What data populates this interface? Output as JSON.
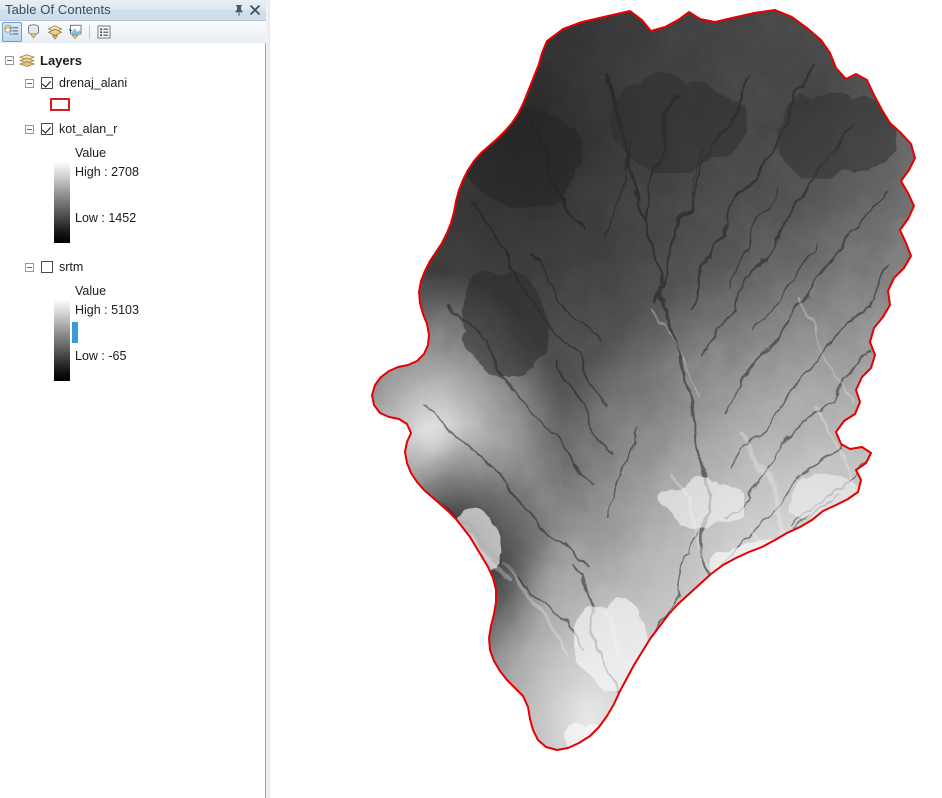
{
  "panel": {
    "title": "Table Of Contents",
    "pin_icon": "pin-icon",
    "close_icon": "close-icon",
    "toolbar": [
      {
        "name": "list-by-drawing-order-icon",
        "active": true
      },
      {
        "name": "list-by-source-icon",
        "active": false
      },
      {
        "name": "list-by-visibility-icon",
        "active": false
      },
      {
        "name": "list-by-selection-icon",
        "active": false
      },
      {
        "name": "options-icon",
        "active": false
      }
    ]
  },
  "tree": {
    "root": {
      "label": "Layers",
      "icon": "layer-stack-icon",
      "expanded": true
    },
    "layers": [
      {
        "name": "drenaj_alani",
        "checked": true,
        "expanded": true,
        "symbol_type": "polygon-outline",
        "outline_color": "#d41f1f",
        "fill_color": "#ffffff"
      },
      {
        "name": "kot_alan_r",
        "checked": true,
        "expanded": true,
        "symbol_type": "stretched-raster",
        "value_label": "Value",
        "high_label": "High : 2708",
        "low_label": "Low : 1452",
        "ramp_high_color": "#ffffff",
        "ramp_low_color": "#000000",
        "selected": false
      },
      {
        "name": "srtm",
        "checked": false,
        "expanded": true,
        "symbol_type": "stretched-raster",
        "value_label": "Value",
        "high_label": "High : 5103",
        "low_label": "Low : -65",
        "ramp_high_color": "#ffffff",
        "ramp_low_color": "#000000",
        "selected": true,
        "selection_color": "#3a9ae0"
      }
    ]
  },
  "map": {
    "background_color": "#ffffff",
    "boundary_color": "#e60000",
    "boundary_layer": "drenaj_alani",
    "raster_layer": "kot_alan_r",
    "raster_render": "grayscale-hillshade-dem",
    "raster_min": 1452,
    "raster_max": 2708
  }
}
